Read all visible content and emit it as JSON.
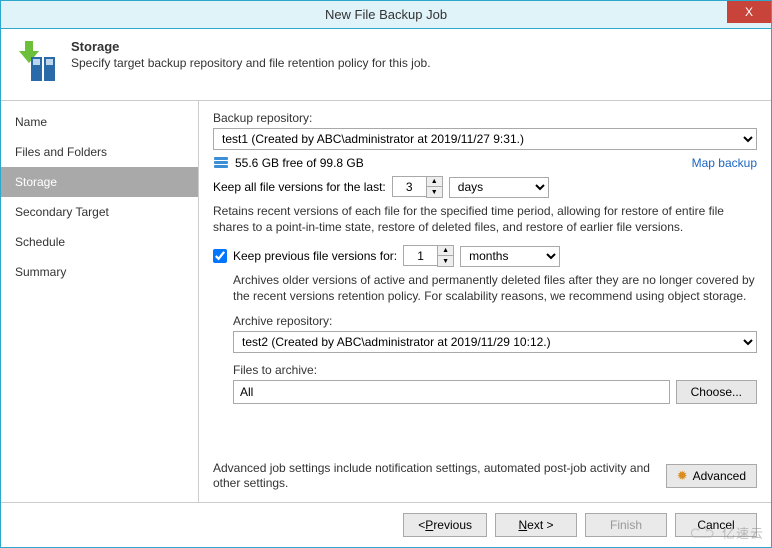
{
  "window": {
    "title": "New File Backup Job",
    "close": "X"
  },
  "header": {
    "title": "Storage",
    "subtitle": "Specify target backup repository and file retention policy for this job."
  },
  "sidebar": {
    "items": [
      {
        "label": "Name"
      },
      {
        "label": "Files and Folders"
      },
      {
        "label": "Storage",
        "selected": true
      },
      {
        "label": "Secondary Target"
      },
      {
        "label": "Schedule"
      },
      {
        "label": "Summary"
      }
    ]
  },
  "content": {
    "repo_label": "Backup repository:",
    "repo_value": "test1 (Created by ABC\\administrator at 2019/11/27 9:31.)",
    "free_space": "55.6 GB free of 99.8 GB",
    "map_backup": "Map backup",
    "keep_label": "Keep all file versions for the last:",
    "keep_value": "3",
    "keep_unit": "days",
    "keep_desc": "Retains recent versions of each file for the specified time period, allowing for restore of entire file shares to a point-in-time state, restore of deleted files, and restore of earlier file versions.",
    "prev_checked": true,
    "prev_label": "Keep previous file versions for:",
    "prev_value": "1",
    "prev_unit": "months",
    "prev_desc": "Archives older versions of active and permanently deleted files after they are no longer covered by the recent versions retention policy. For scalability reasons, we recommend using object storage.",
    "archive_label": "Archive repository:",
    "archive_value": "test2 (Created by ABC\\administrator at 2019/11/29 10:12.)",
    "files_label": "Files to archive:",
    "files_value": "All",
    "choose": "Choose...",
    "advanced_text": "Advanced job settings include notification settings, automated post-job activity and other settings.",
    "advanced_btn": "Advanced"
  },
  "footer": {
    "previous": "Previous",
    "next": "Next >",
    "finish": "Finish",
    "cancel": "Cancel"
  },
  "watermark": "亿速云"
}
